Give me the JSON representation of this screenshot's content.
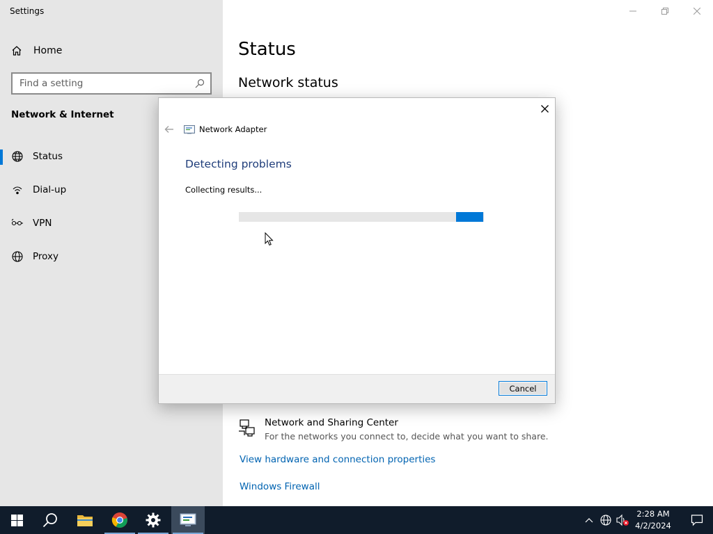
{
  "settings": {
    "app_title": "Settings",
    "home_label": "Home",
    "search_placeholder": "Find a setting",
    "section_title": "Network & Internet",
    "nav": [
      {
        "label": "Status",
        "icon": "globe-network-icon",
        "active": true
      },
      {
        "label": "Dial-up",
        "icon": "dial-up-icon",
        "active": false
      },
      {
        "label": "VPN",
        "icon": "vpn-icon",
        "active": false
      },
      {
        "label": "Proxy",
        "icon": "globe-icon",
        "active": false
      }
    ]
  },
  "main": {
    "title": "Status",
    "subtitle": "Network status",
    "sharing_center": {
      "title": "Network and Sharing Center",
      "description": "For the networks you connect to, decide what you want to share."
    },
    "links": [
      "View hardware and connection properties",
      "Windows Firewall"
    ]
  },
  "dialog": {
    "app_title": "Network Adapter",
    "heading": "Detecting problems",
    "status": "Collecting results...",
    "progress_indeterminate": true,
    "cancel_label": "Cancel"
  },
  "taskbar": {
    "apps": [
      "start-icon",
      "search-icon",
      "file-explorer-icon",
      "chrome-icon",
      "settings-gear-icon",
      "network-diagnostics-icon"
    ],
    "time": "2:28 AM",
    "date": "4/2/2024"
  },
  "colors": {
    "accent": "#0078d7",
    "sidebar_bg": "#e6e6e6",
    "link": "#0063b1",
    "heading": "#1f3d7a",
    "taskbar_bg": "#101c2b"
  }
}
